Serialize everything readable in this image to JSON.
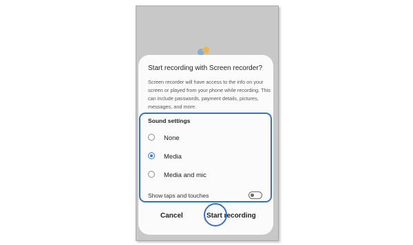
{
  "dialog": {
    "title": "Start recording with Screen recorder?",
    "description": "Screen recorder will have access to the info on your screen or played from your phone while recording. This can include passwords, payment details, pictures, messages, and more."
  },
  "sound_settings": {
    "title": "Sound settings",
    "options": [
      {
        "label": "None",
        "selected": false
      },
      {
        "label": "Media",
        "selected": true
      },
      {
        "label": "Media and mic",
        "selected": false
      }
    ]
  },
  "show_taps": {
    "label": "Show taps and touches",
    "enabled": false
  },
  "buttons": {
    "cancel": "Cancel",
    "start": "Start recording"
  },
  "colors": {
    "accent": "#2a7be4",
    "highlight": "#2f6fd6",
    "phone_bg": "#c8c8c8",
    "dialog_bg": "#fbfbfb"
  }
}
